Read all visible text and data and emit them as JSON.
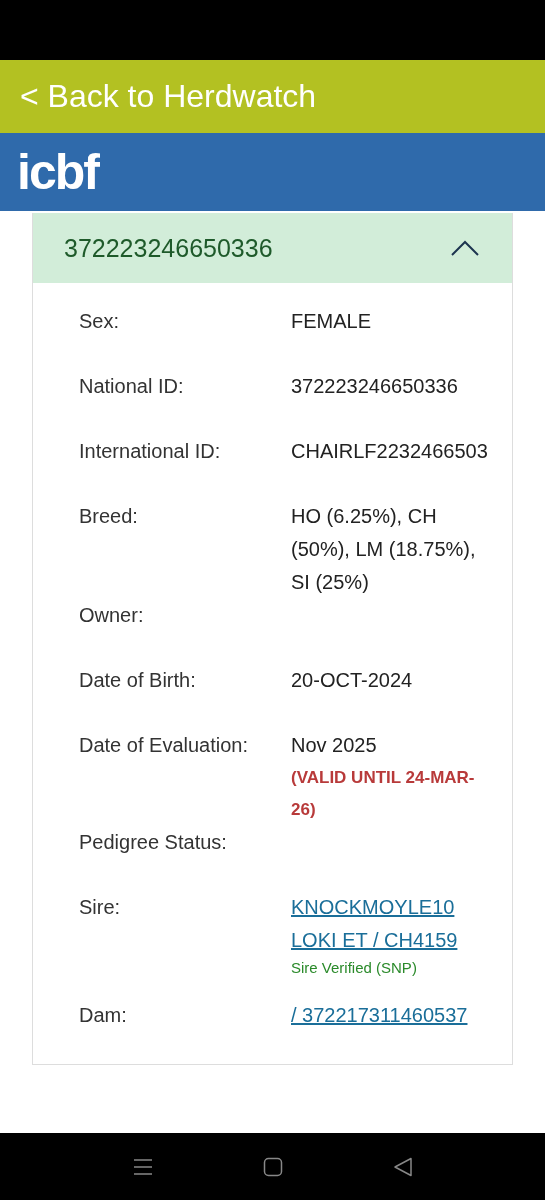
{
  "back_link": {
    "label": "< Back to Herdwatch"
  },
  "brand": {
    "logo": "icbf"
  },
  "animal_card": {
    "title": "372223246650336",
    "expanded": true,
    "rows": [
      {
        "label": "Sex:",
        "value": "FEMALE"
      },
      {
        "label": "National ID:",
        "value": "372223246650336"
      },
      {
        "label": "International ID:",
        "value": "CHAIRLF2232466503"
      },
      {
        "label": "Breed:",
        "value": "HO (6.25%), CH (50%), LM (18.75%), SI (25%)"
      },
      {
        "label": "Owner:"
      },
      {
        "label": "Date of Birth:",
        "value": "20-OCT-2024"
      },
      {
        "label": "Date of Evaluation:",
        "value": "Nov 2025",
        "note": "(VALID UNTIL 24-MAR-26)"
      },
      {
        "label": "Pedigree Status:"
      },
      {
        "label": "Sire:",
        "link": "KNOCKMOYLE10 LOKI ET / CH4159",
        "verification": "Sire Verified (SNP)"
      },
      {
        "label": "Dam:",
        "link": "/ 372217311460537"
      }
    ]
  }
}
